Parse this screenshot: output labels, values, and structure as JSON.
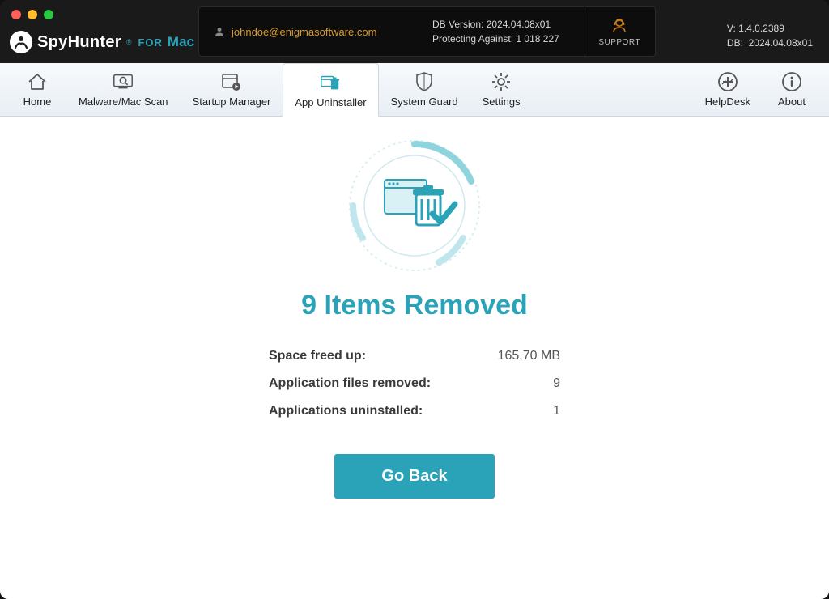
{
  "header": {
    "user_email": "johndoe@enigmasoftware.com",
    "db_version_label": "DB Version:",
    "db_version_value": "2024.04.08x01",
    "protecting_label": "Protecting Against:",
    "protecting_value": "1 018 227",
    "support_label": "SUPPORT",
    "app_version_label": "V:",
    "app_version_value": "1.4.0.2389",
    "app_db_label": "DB:",
    "app_db_value": "2024.04.08x01"
  },
  "logo": {
    "name": "SpyHunter",
    "for": "FOR",
    "mac": "Mac"
  },
  "toolbar": {
    "home": "Home",
    "malware_scan": "Malware/Mac Scan",
    "startup_manager": "Startup Manager",
    "app_uninstaller": "App Uninstaller",
    "system_guard": "System Guard",
    "settings": "Settings",
    "helpdesk": "HelpDesk",
    "about": "About"
  },
  "result": {
    "headline": "9 Items Removed",
    "rows": [
      {
        "label": "Space freed up:",
        "value": "165,70 MB"
      },
      {
        "label": "Application files removed:",
        "value": "9"
      },
      {
        "label": "Applications uninstalled:",
        "value": "1"
      }
    ],
    "go_back": "Go Back"
  }
}
